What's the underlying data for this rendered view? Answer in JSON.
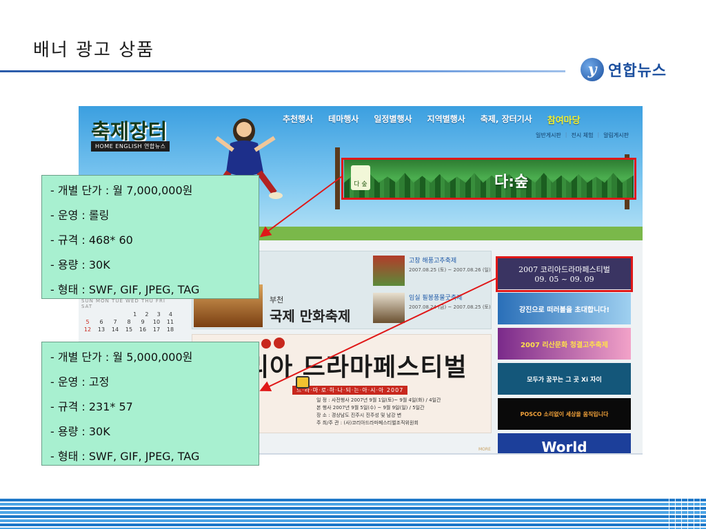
{
  "slide": {
    "title": "배너 광고 상품",
    "logo_text": "연합뉴스",
    "logo_mark": "y"
  },
  "site": {
    "logo": "축제장터",
    "links": "HOME  ENGLISH  연합뉴스",
    "nav": [
      "추천행사",
      "테마행사",
      "일정별행사",
      "지역별행사",
      "축제, 장터기사",
      "참여마당"
    ],
    "subnav": [
      "일반게시판",
      "전시 체험",
      "알림게시판"
    ],
    "banner_main": "다:숲",
    "banner_small": "다 숲",
    "calendar": {
      "head": "SUN MON TUE WED THU FRI SAT",
      "rows": [
        [
          "",
          "",
          "",
          "",
          "1",
          "2",
          "3",
          "4"
        ],
        [
          "5",
          "6",
          "7",
          "8",
          "9",
          "10",
          "11"
        ],
        [
          "12",
          "13",
          "14",
          "15",
          "16",
          "17",
          "18"
        ]
      ]
    },
    "festival": {
      "city": "부천",
      "name": "국제 만화축제",
      "events": [
        {
          "name": "고창 해풍고추축제",
          "date": "2007.08.25 (토) ~ 2007.08.26 (일)"
        },
        {
          "name": "임실 필봉풍물굿축제",
          "date": "2007.08.24 (금) ~ 2007.08.25 (토)"
        }
      ]
    },
    "drama": {
      "title": "리아 드라마페스티벌",
      "sub": "드·라·마·로·하·나·되·는·아·시·아 2007",
      "lines": [
        "일     정 : 사전행사 2007년 9월 1일(토)~ 9월 4일(화) / 4일간",
        "            본  행사 2007년 9월 5일(수) ~ 9월 9일(일) / 5일간",
        "장     소 : 경상남도 진주시 진주성 및 남강 변",
        "주 최/주 관 : (사)코리아드라마페스티벌조직위원회"
      ],
      "more": "MORE"
    },
    "right_banners": [
      {
        "line1": "2007 코리아드라마페스티벌",
        "line2": "09. 05 ~ 09. 09"
      },
      {
        "text": "강진으로 떠러볼을 초대합니다!"
      },
      {
        "text": "2007 리산문화 청결고추축제"
      },
      {
        "text": "모두가 꿈꾸는 그 곳  Xi 자이"
      },
      {
        "text": "POSCO  소리없이 세상을 움직입니다"
      },
      {
        "text": "World"
      }
    ]
  },
  "callouts": [
    {
      "lines": [
        "- 개별 단가 : 월 7,000,000원",
        "- 운영 : 롤링",
        "- 규격 : 468* 60",
        "- 용량 : 30K",
        "- 형태 : SWF, GIF, JPEG, TAG"
      ]
    },
    {
      "lines": [
        "- 개별 단가 : 월 5,000,000원",
        "- 운영 : 고정",
        "- 규격 : 231* 57",
        "- 용량 : 30K",
        "- 형태 : SWF, GIF, JPEG, TAG"
      ]
    }
  ],
  "colors": {
    "callout_bg": "#a8f0d0",
    "highlight": "#e01818",
    "rule": "#2a5aa8"
  }
}
